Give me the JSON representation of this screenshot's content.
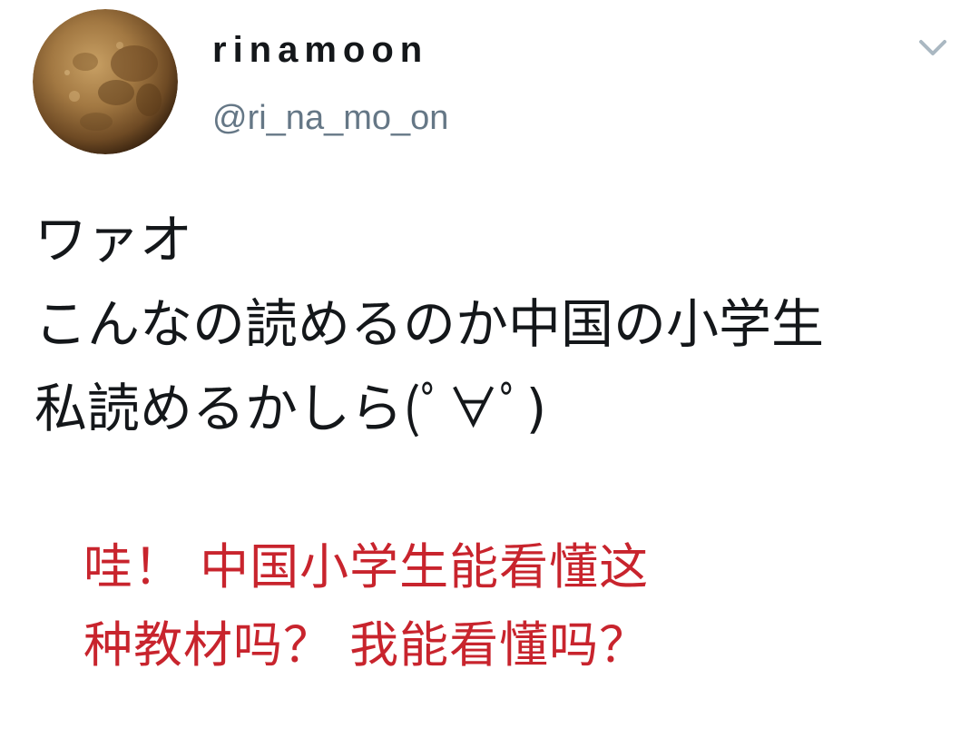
{
  "user": {
    "display_name": "rinamoon",
    "handle": "@ri_na_mo_on",
    "avatar_icon": "moon-avatar-icon"
  },
  "menu": {
    "icon": "chevron-down-icon",
    "color": "#aab8c2"
  },
  "tweet": {
    "lines": [
      "ワァオ",
      "こんなの読めるのか中国の小学生",
      "私読めるかしら(ﾟ∀ﾟ)"
    ],
    "text_color": "#14171a"
  },
  "annotation": {
    "lines": [
      "哇！ 中国小学生能看懂这",
      "种教材吗？ 我能看懂吗？"
    ],
    "color": "#c8242d"
  },
  "colors": {
    "secondary_text": "#657786",
    "background": "#ffffff"
  }
}
